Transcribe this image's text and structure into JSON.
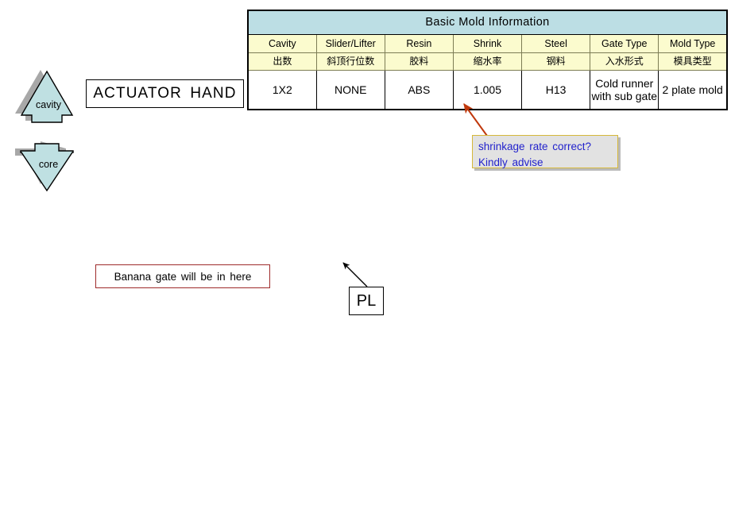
{
  "title_box": {
    "label": "ACTUATOR  HAND"
  },
  "table": {
    "title": "Basic  Mold Information",
    "columns": [
      {
        "en": "Cavity",
        "cn": "出数",
        "value": "1X2"
      },
      {
        "en": "Slider/Lifter",
        "cn": "斜顶行位数",
        "value": "NONE"
      },
      {
        "en": "Resin",
        "cn": "胶料",
        "value": "ABS"
      },
      {
        "en": "Shrink",
        "cn": "缩水率",
        "value": "1.005"
      },
      {
        "en": "Steel",
        "cn": "钢料",
        "value": "H13"
      },
      {
        "en": "Gate Type",
        "cn": "入水形式",
        "value": "Cold runner with sub gate"
      },
      {
        "en": "Mold Type",
        "cn": "模具类型",
        "value": "2 plate mold"
      }
    ],
    "colors": {
      "title_fill": "#bcdee4",
      "header_fill": "#fbfbce",
      "data_fill": "#ffffff",
      "grid": "#7d7d55",
      "outline": "#000000"
    }
  },
  "callout": {
    "line1": "shrinkage  rate correct?",
    "line2": "Kindly  advise",
    "fill": "#e2e2e2",
    "border": "#d6b83a",
    "text_color": "#2222cc",
    "arrow_color": "#c0380c"
  },
  "shapes": {
    "cavity_label": "cavity",
    "core_label": "core",
    "fill": "#bfe0e2",
    "stroke": "#000000",
    "shadow": "#a8a8a8"
  },
  "banana_note": {
    "label": "Banana  gate will be in here",
    "border": "#9e2a2a"
  },
  "pl_marker": {
    "label": "PL",
    "arrow_color": "#000000"
  }
}
